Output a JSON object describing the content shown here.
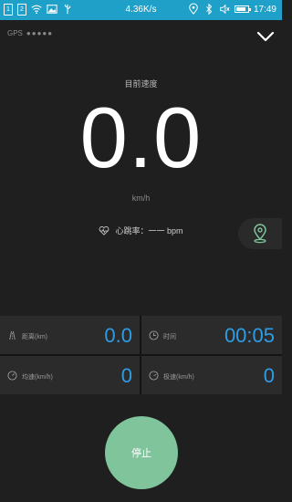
{
  "statusbar": {
    "network_speed": "4.36K/s",
    "time": "17:49",
    "sim1": "1",
    "sim2": "2",
    "battery_level": 0.85
  },
  "header": {
    "gps_label": "GPS",
    "gps_signal": "●●●●●"
  },
  "speed": {
    "label": "目前速度",
    "value": "0.0",
    "unit": "km/h"
  },
  "heart_rate": {
    "text": "心跳率：一一 bpm"
  },
  "stats": {
    "distance_label": "距离(km)",
    "distance_value": "0.0",
    "time_label": "时间",
    "time_value": "00:05",
    "avg_speed_label": "均速(km/h)",
    "avg_speed_value": "0",
    "max_speed_label": "极速(km/h)",
    "max_speed_value": "0"
  },
  "actions": {
    "stop_label": "停止"
  },
  "colors": {
    "statusbar": "#1ea0c9",
    "accent_value": "#2d9de6",
    "stop_button": "#7fc49b",
    "map_icon": "#7fc49b"
  }
}
